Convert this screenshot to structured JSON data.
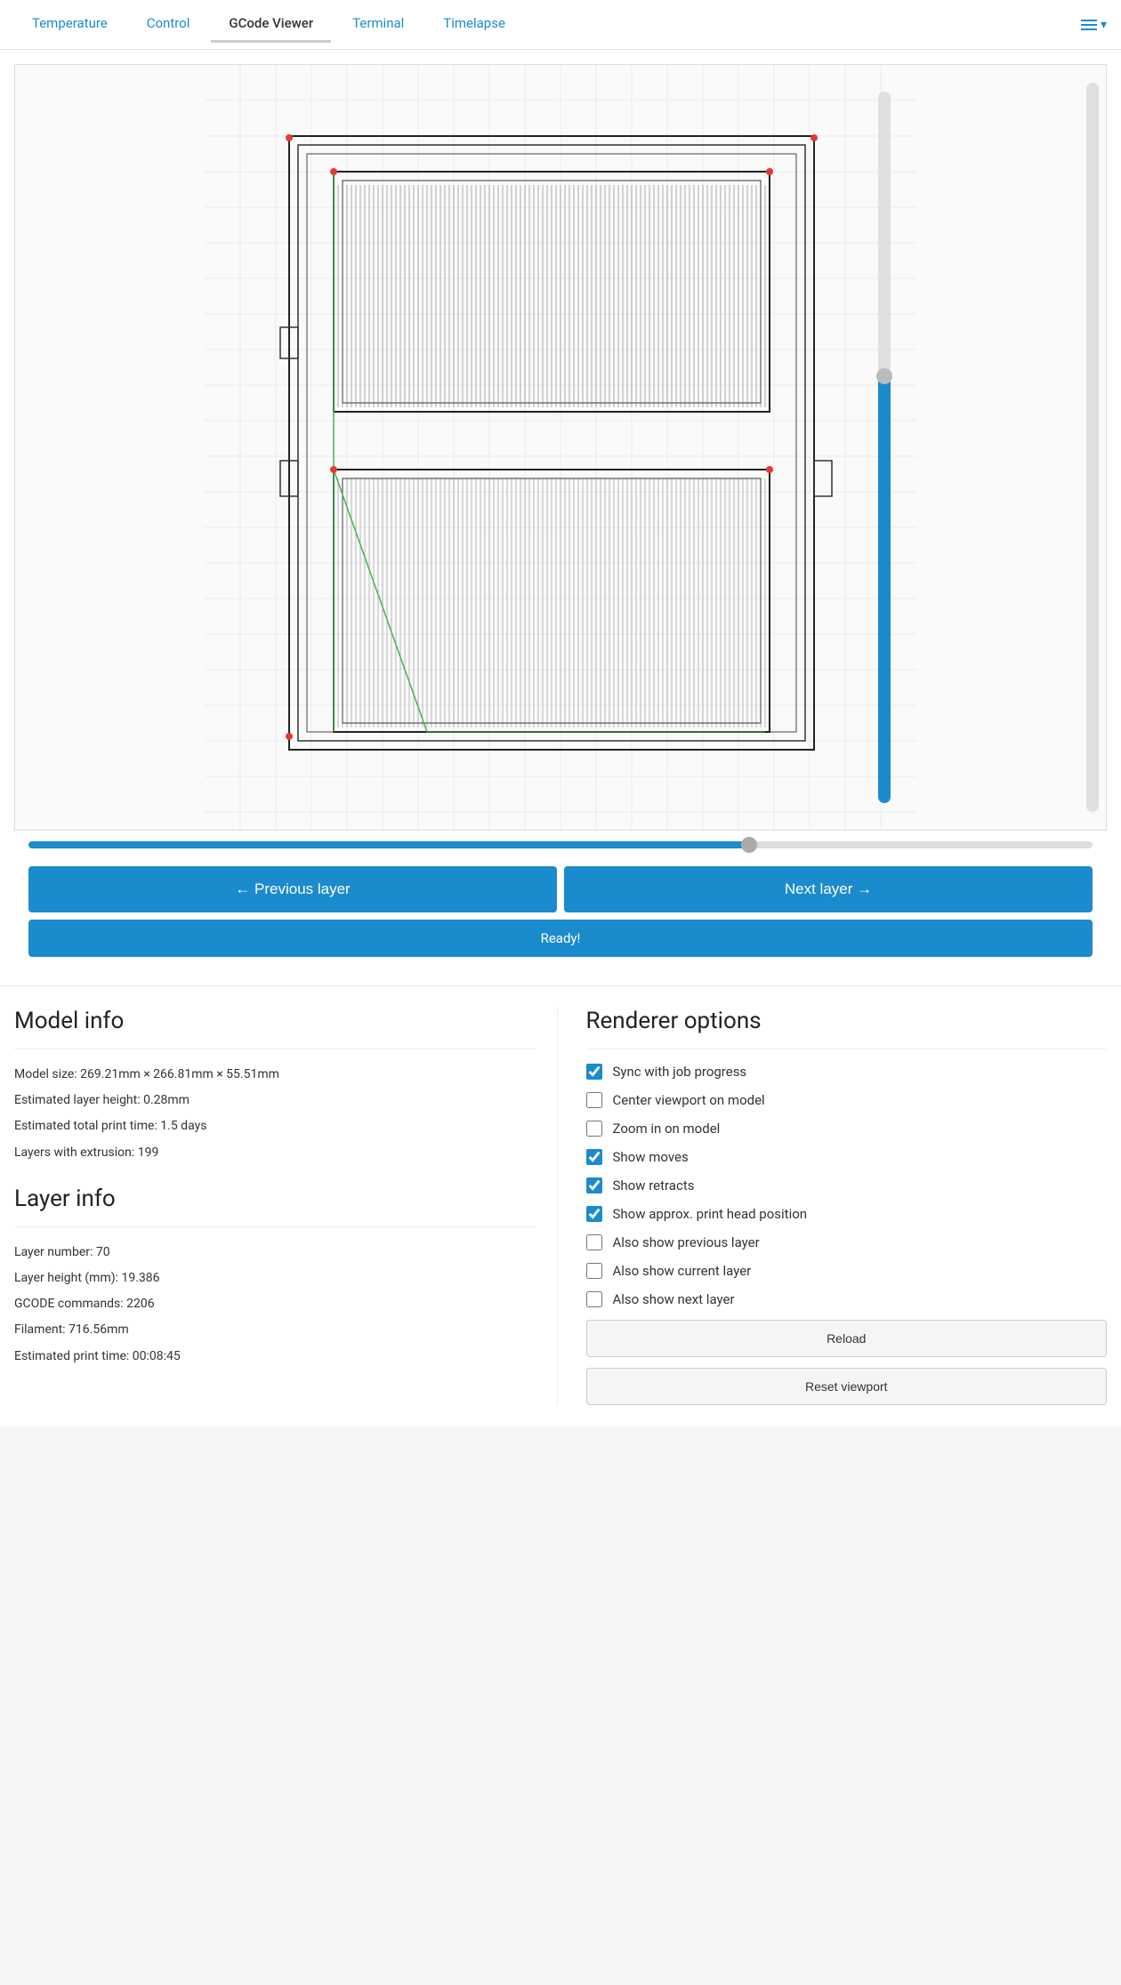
{
  "tabs": [
    {
      "label": "Temperature",
      "active": false
    },
    {
      "label": "Control",
      "active": false
    },
    {
      "label": "GCode Viewer",
      "active": true
    },
    {
      "label": "Terminal",
      "active": false
    },
    {
      "label": "Timelapse",
      "active": false
    }
  ],
  "viewer": {
    "h_slider_value": 68
  },
  "buttons": {
    "prev_layer": "← Previous layer",
    "next_layer": "Next layer →",
    "ready": "Ready!",
    "reload": "Reload",
    "reset_viewport": "Reset viewport"
  },
  "model_info": {
    "title": "Model info",
    "size": "Model size: 269.21mm × 266.81mm × 55.51mm",
    "layer_height": "Estimated layer height: 0.28mm",
    "print_time": "Estimated total print time: 1.5 days",
    "layers_extrusion": "Layers with extrusion: 199"
  },
  "layer_info": {
    "title": "Layer info",
    "layer_number": "Layer number: 70",
    "layer_height": "Layer height (mm): 19.386",
    "gcode_commands": "GCODE commands: 2206",
    "filament": "Filament: 716.56mm",
    "estimated_print_time": "Estimated print time: 00:08:45"
  },
  "renderer_options": {
    "title": "Renderer options",
    "options": [
      {
        "label": "Sync with job progress",
        "checked": true,
        "name": "sync-job-progress"
      },
      {
        "label": "Center viewport on model",
        "checked": false,
        "name": "center-viewport"
      },
      {
        "label": "Zoom in on model",
        "checked": false,
        "name": "zoom-on-model"
      },
      {
        "label": "Show moves",
        "checked": true,
        "name": "show-moves"
      },
      {
        "label": "Show retracts",
        "checked": true,
        "name": "show-retracts"
      },
      {
        "label": "Show approx. print head position",
        "checked": true,
        "name": "show-print-head"
      },
      {
        "label": "Also show previous layer",
        "checked": false,
        "name": "show-prev-layer"
      },
      {
        "label": "Also show current layer",
        "checked": false,
        "name": "show-current-layer"
      },
      {
        "label": "Also show next layer",
        "checked": false,
        "name": "show-next-layer"
      }
    ]
  }
}
